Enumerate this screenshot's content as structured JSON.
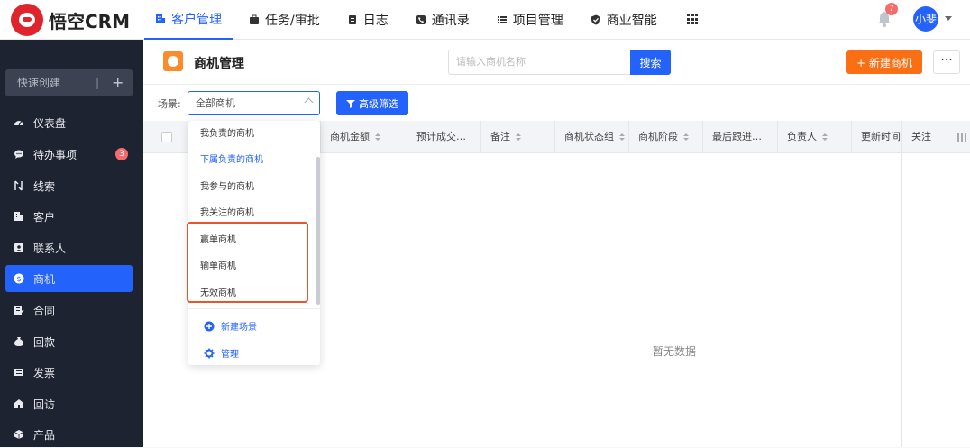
{
  "app": {
    "logo_text": "悟空CRM"
  },
  "top_nav": [
    {
      "label": "客户管理",
      "icon": "building-icon",
      "active": true
    },
    {
      "label": "任务/审批",
      "icon": "briefcase-icon"
    },
    {
      "label": "日志",
      "icon": "notebook-icon"
    },
    {
      "label": "通讯录",
      "icon": "phone-icon"
    },
    {
      "label": "项目管理",
      "icon": "list-icon"
    },
    {
      "label": "商业智能",
      "icon": "shield-check-icon"
    }
  ],
  "notifications": {
    "count": "7"
  },
  "user": {
    "name": "小斐"
  },
  "sidebar": {
    "quick_create": "快速创建",
    "quick_sep": "|",
    "quick_plus": "+",
    "items": [
      {
        "label": "仪表盘",
        "icon": "dashboard-icon"
      },
      {
        "label": "待办事项",
        "icon": "chat-icon",
        "badge": "3"
      },
      {
        "label": "线索",
        "icon": "clue-icon"
      },
      {
        "label": "客户",
        "icon": "customer-icon"
      },
      {
        "label": "联系人",
        "icon": "contact-icon"
      },
      {
        "label": "商机",
        "icon": "opportunity-icon",
        "active": true
      },
      {
        "label": "合同",
        "icon": "contract-icon"
      },
      {
        "label": "回款",
        "icon": "payment-icon"
      },
      {
        "label": "发票",
        "icon": "invoice-icon"
      },
      {
        "label": "回访",
        "icon": "visit-icon"
      },
      {
        "label": "产品",
        "icon": "product-icon"
      }
    ]
  },
  "page": {
    "title": "商机管理",
    "search_placeholder": "请输入商机名称",
    "search_button": "搜索",
    "new_button": "+ 新建商机",
    "more_button": "···"
  },
  "filters": {
    "scene_label": "场景:",
    "scene_value": "全部商机",
    "advanced_button": "高级筛选"
  },
  "table": {
    "columns": [
      "商机金额",
      "预计成交…",
      "备注",
      "商机状态组",
      "商机阶段",
      "最后跟进…",
      "负责人",
      "更新时间",
      "关注"
    ],
    "empty_text": "暂无数据"
  },
  "scene_dropdown": {
    "items": [
      "我负责的商机",
      "下属负责的商机",
      "我参与的商机",
      "我关注的商机",
      "赢单商机",
      "输单商机",
      "无效商机"
    ],
    "active_index": 1,
    "actions": [
      {
        "label": "新建场景",
        "icon": "plus-circle-icon"
      },
      {
        "label": "管理",
        "icon": "gear-icon"
      }
    ]
  },
  "colors": {
    "primary": "#2362fb",
    "accent_orange": "#fb6f14",
    "sidebar_bg": "#1e2331",
    "highlight": "#e8542c"
  }
}
